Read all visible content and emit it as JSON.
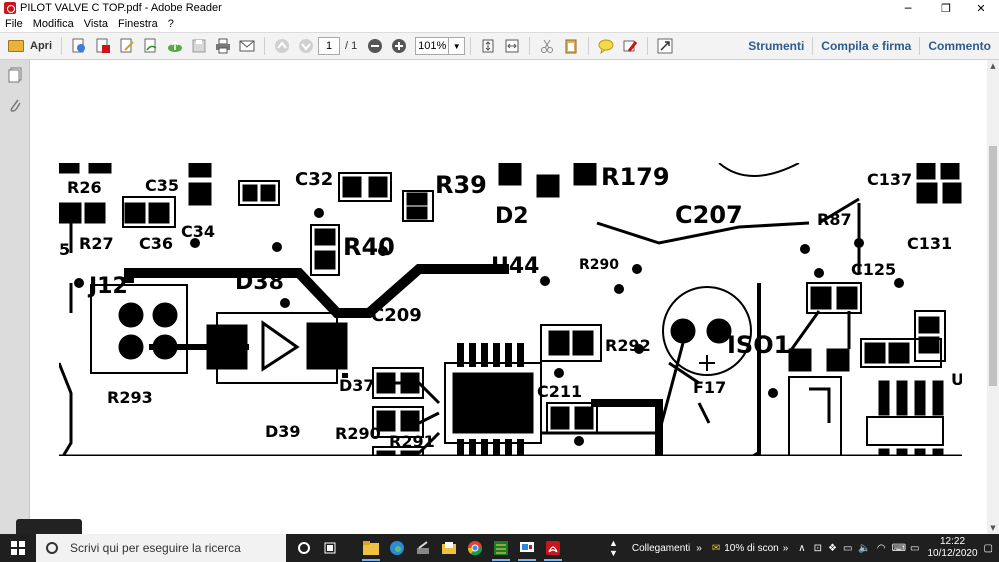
{
  "window": {
    "title": "PILOT VALVE C TOP.pdf - Adobe Reader",
    "minimize": "─",
    "maximize": "❐",
    "close": "✕"
  },
  "menu": [
    "File",
    "Modifica",
    "Vista",
    "Finestra",
    "?"
  ],
  "toolbar": {
    "open_label": "Apri",
    "page_current": "1",
    "page_total": "/ 1",
    "zoom": "101%",
    "tools_link": "Strumenti",
    "fill_sign_link": "Compila e firma",
    "comment_link": "Commento"
  },
  "pcb": {
    "labels": [
      "R26",
      "C35",
      "R27",
      "C36",
      "C34",
      "C32",
      "R39",
      "R40",
      "D2",
      "R179",
      "C207",
      "C137",
      "R87",
      "C131",
      "C125",
      "U44",
      "R290",
      "J12",
      "D38",
      "C209",
      "ISO1",
      "R292",
      "D37",
      "C211",
      "F17",
      "R293",
      "D39",
      "R290",
      "R291",
      "5",
      "U"
    ]
  },
  "taskbar": {
    "search_placeholder": "Scrivi qui per eseguire la ricerca",
    "links_label": "Collegamenti",
    "scan_notice": "10% di scon",
    "time": "12:22",
    "date": "10/12/2020"
  },
  "colors": {
    "toolbar_bg": "#f3f3f3",
    "link_blue": "#2d5c8c",
    "taskbar_bg": "#1f1f1f",
    "doc_bg": "#8f8f8f"
  }
}
